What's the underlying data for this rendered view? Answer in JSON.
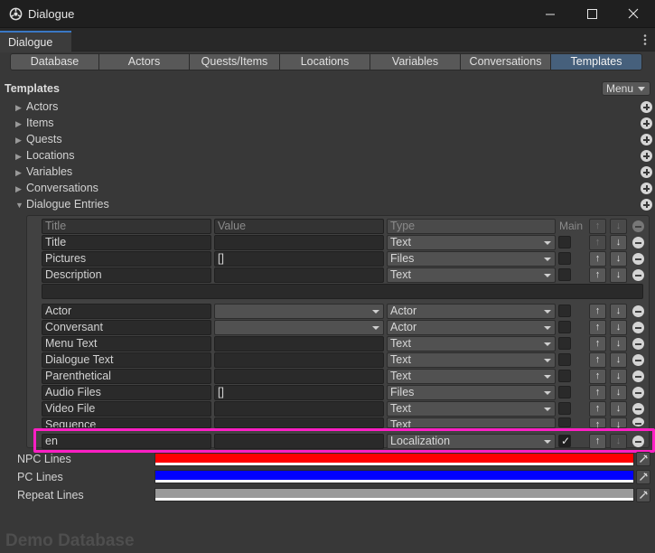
{
  "window": {
    "title": "Dialogue"
  },
  "tab": {
    "label": "Dialogue"
  },
  "toolbar": {
    "tabs": [
      {
        "label": "Database",
        "active": false
      },
      {
        "label": "Actors",
        "active": false
      },
      {
        "label": "Quests/Items",
        "active": false
      },
      {
        "label": "Locations",
        "active": false
      },
      {
        "label": "Variables",
        "active": false
      },
      {
        "label": "Conversations",
        "active": false
      },
      {
        "label": "Templates",
        "active": true
      }
    ]
  },
  "section": {
    "title": "Templates",
    "menu_label": "Menu"
  },
  "foldouts": [
    {
      "label": "Actors",
      "expanded": false
    },
    {
      "label": "Items",
      "expanded": false
    },
    {
      "label": "Quests",
      "expanded": false
    },
    {
      "label": "Locations",
      "expanded": false
    },
    {
      "label": "Variables",
      "expanded": false
    },
    {
      "label": "Conversations",
      "expanded": false
    },
    {
      "label": "Dialogue Entries",
      "expanded": true
    }
  ],
  "table": {
    "headers": {
      "title": "Title",
      "value": "Value",
      "type": "Type",
      "main": "Main"
    },
    "rows": [
      {
        "title": "Title",
        "value": "",
        "type": "Text",
        "main": false
      },
      {
        "title": "Pictures",
        "value": "[]",
        "type": "Files",
        "main": false
      },
      {
        "title": "Description",
        "value": "",
        "type": "Text",
        "main": false
      },
      {
        "title": "Actor",
        "value": "",
        "type": "Actor",
        "main": false
      },
      {
        "title": "Conversant",
        "value": "",
        "type": "Actor",
        "main": false
      },
      {
        "title": "Menu Text",
        "value": "",
        "type": "Text",
        "main": false
      },
      {
        "title": "Dialogue Text",
        "value": "",
        "type": "Text",
        "main": false
      },
      {
        "title": "Parenthetical",
        "value": "",
        "type": "Text",
        "main": false
      },
      {
        "title": "Audio Files",
        "value": "[]",
        "type": "Files",
        "main": false
      },
      {
        "title": "Video File",
        "value": "",
        "type": "Text",
        "main": false
      },
      {
        "title": "Sequence",
        "value": "",
        "type": "Text",
        "main": false
      },
      {
        "title": "en",
        "value": "",
        "type": "Localization",
        "main": true
      }
    ]
  },
  "colors": {
    "items": [
      {
        "label": "NPC Lines",
        "color": "#ff0000"
      },
      {
        "label": "PC Lines",
        "color": "#0000ff"
      },
      {
        "label": "Repeat Lines",
        "color": "#9a9a9a"
      }
    ],
    "highlight": "#ff1fc4"
  },
  "footer": {
    "label": "Demo Database"
  }
}
